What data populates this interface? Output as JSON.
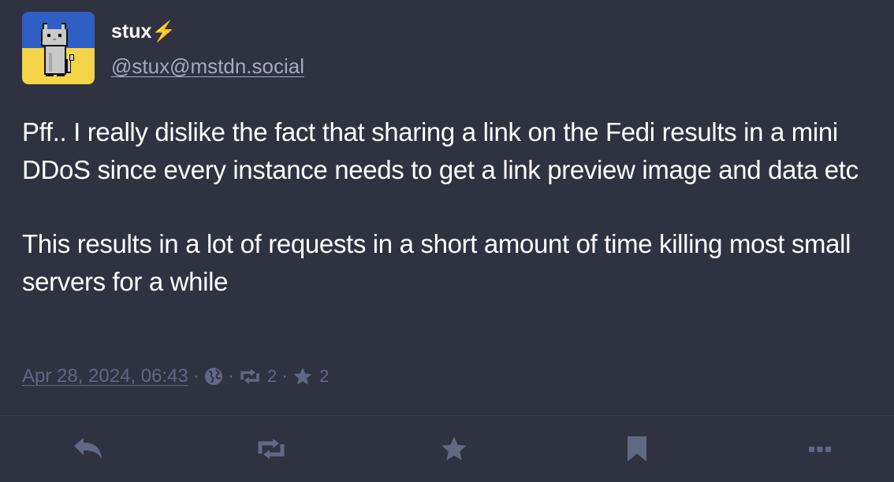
{
  "status": {
    "author": {
      "display_name": "stux",
      "display_emoji": "⚡",
      "handle": "@stux@mstdn.social"
    },
    "content": {
      "paragraphs": [
        "Pff.. I really dislike the fact that sharing a link on the Fedi results in a mini DDoS since every instance needs to get a link preview image and data etc",
        "This results in a lot of requests in a short amount of time killing most small servers for a while"
      ]
    },
    "meta": {
      "timestamp": "Apr 28, 2024, 06:43",
      "separator": "·",
      "visibility_icon": "globe-icon",
      "boost_count": "2",
      "favourite_count": "2"
    }
  },
  "actions": {
    "reply_icon": "reply-icon",
    "boost_icon": "boost-icon",
    "favourite_icon": "star-icon",
    "bookmark_icon": "bookmark-icon",
    "more_icon": "ellipsis-icon"
  },
  "colors": {
    "background": "#2f3241",
    "text": "#ffffff",
    "muted": "#606984",
    "handle": "#a7aac0",
    "avatar_blue": "#2f5fc4",
    "avatar_yellow": "#f5d547"
  }
}
